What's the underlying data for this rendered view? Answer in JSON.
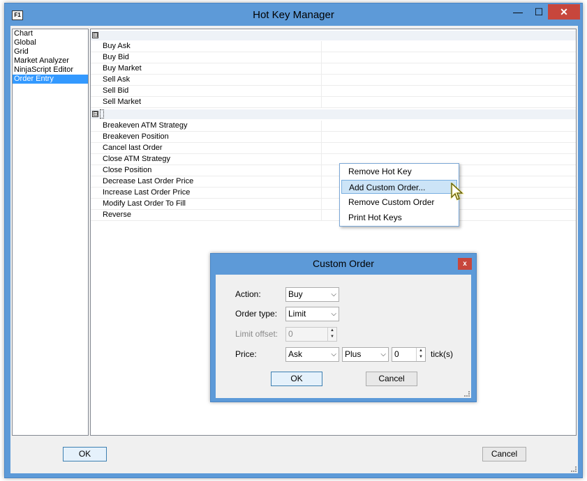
{
  "window": {
    "title": "Hot Key Manager",
    "icon_text": "F1",
    "min_glyph": "—",
    "max_glyph": "☐",
    "close_glyph": "✕"
  },
  "categories": [
    {
      "label": "Chart"
    },
    {
      "label": "Global"
    },
    {
      "label": "Grid"
    },
    {
      "label": "Market Analyzer"
    },
    {
      "label": "NinjaScript Editor"
    },
    {
      "label": "Order Entry",
      "selected": true
    }
  ],
  "grid": {
    "expander_glyph": "⊟",
    "group1": [
      "Buy Ask",
      "Buy Bid",
      "Buy Market",
      "Sell Ask",
      "Sell Bid",
      "Sell Market"
    ],
    "group2": [
      "Breakeven ATM Strategy",
      "Breakeven Position",
      "Cancel last Order",
      "Close ATM Strategy",
      "Close Position",
      "Decrease Last Order Price",
      "Increase Last Order Price",
      "Modify Last Order To Fill",
      "Reverse"
    ]
  },
  "context_menu": {
    "items": [
      {
        "label": "Remove Hot Key"
      },
      {
        "label": "Add Custom Order...",
        "highlighted": true
      },
      {
        "label": "Remove Custom Order"
      },
      {
        "label": "Print Hot Keys"
      }
    ]
  },
  "custom_order": {
    "title": "Custom Order",
    "close_glyph": "x",
    "action_label": "Action:",
    "action_value": "Buy",
    "order_type_label": "Order type:",
    "order_type_value": "Limit",
    "limit_offset_label": "Limit offset:",
    "limit_offset_value": "0",
    "price_label": "Price:",
    "price_value": "Ask",
    "price_mode_value": "Plus",
    "ticks_value": "0",
    "ticks_label": "tick(s)",
    "ok_label": "OK",
    "cancel_label": "Cancel",
    "arrow_glyph": "⌵"
  },
  "footer": {
    "ok_label": "OK",
    "cancel_label": "Cancel"
  }
}
